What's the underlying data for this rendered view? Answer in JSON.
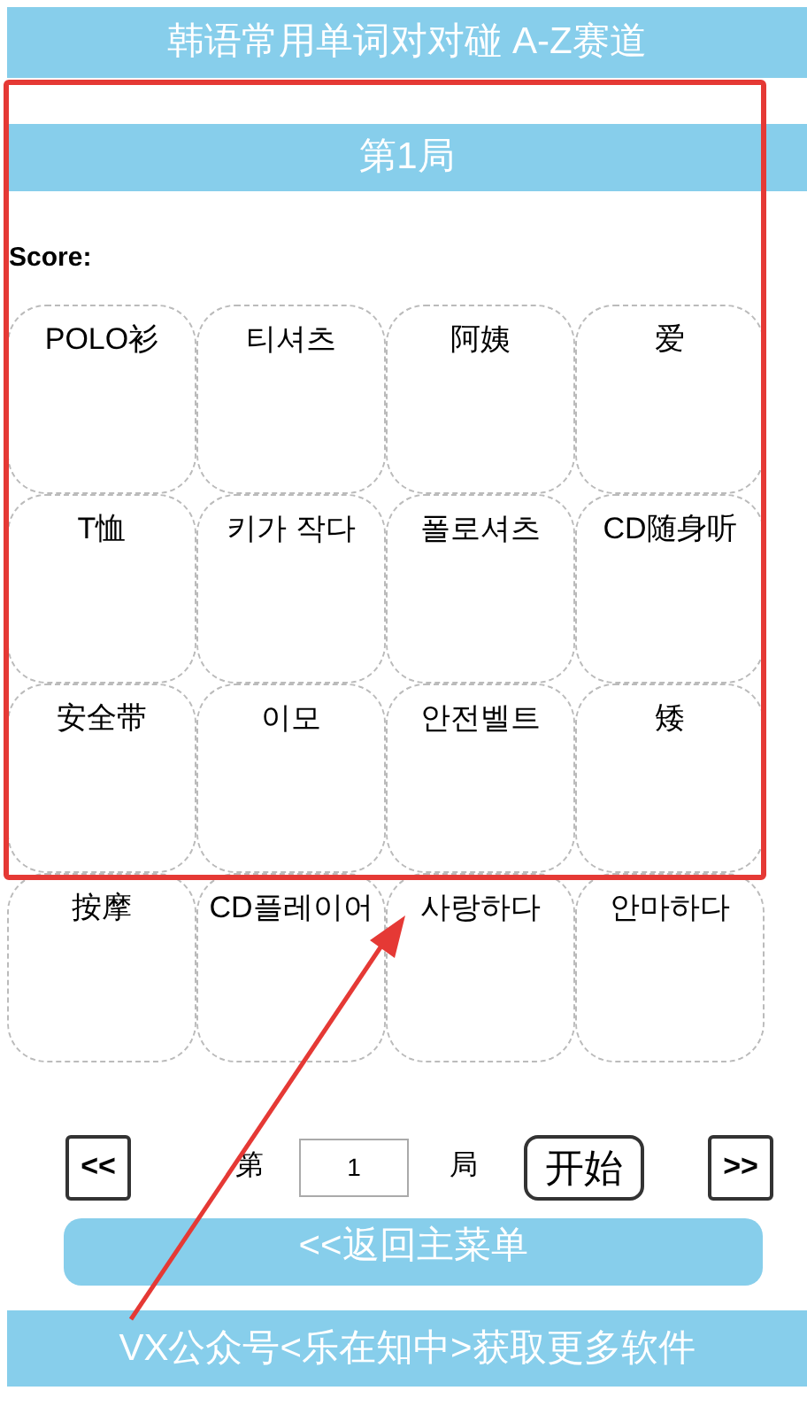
{
  "title": "韩语常用单词对对碰 A-Z赛道",
  "round_title": "第1局",
  "score_label": "Score:",
  "cards": [
    "POLO衫",
    "티셔츠",
    "阿姨",
    "爱",
    "T恤",
    "키가 작다",
    "폴로셔츠",
    "CD随身听",
    "安全带",
    "이모",
    "안전벨트",
    "矮",
    "按摩",
    "CD플레이어",
    "사랑하다",
    "안마하다"
  ],
  "controls": {
    "prev": "<<",
    "round_prefix": "第",
    "round_value": "1",
    "round_suffix": "局",
    "start": "开始",
    "next": ">>"
  },
  "back_button": "<<返回主菜单",
  "footer": "VX公众号<乐在知中>获取更多软件"
}
